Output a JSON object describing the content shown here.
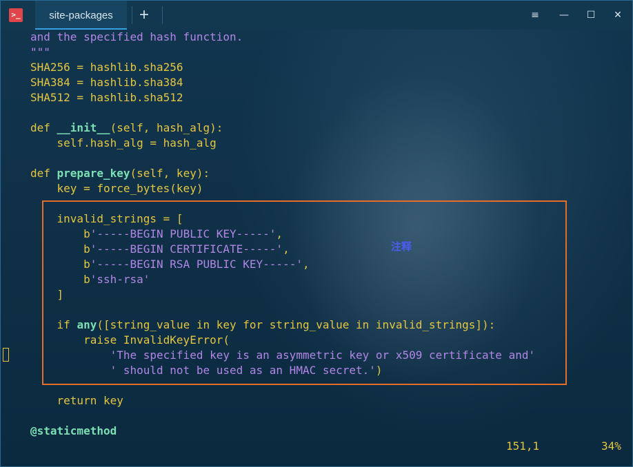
{
  "titlebar": {
    "tab_label": "site-packages",
    "new_tab_label": "+",
    "menu_label": "≡",
    "minimize_label": "—",
    "maximize_label": "☐",
    "close_label": "✕",
    "app_icon_label": ">_"
  },
  "code": {
    "lines": [
      [
        {
          "t": "and the specified hash function.",
          "c": "str"
        }
      ],
      [
        {
          "t": "\"\"\"",
          "c": "str"
        }
      ],
      [
        {
          "t": "SHA256 = hashlib.sha256",
          "c": "kw"
        }
      ],
      [
        {
          "t": "SHA384 = hashlib.sha384",
          "c": "kw"
        }
      ],
      [
        {
          "t": "SHA512 = hashlib.sha512",
          "c": "kw"
        }
      ],
      [
        {
          "t": "",
          "c": "kw"
        }
      ],
      [
        {
          "t": "def ",
          "c": "kw"
        },
        {
          "t": "__init__",
          "c": "fn"
        },
        {
          "t": "(self, hash_alg):",
          "c": "kw"
        }
      ],
      [
        {
          "t": "    self.hash_alg = hash_alg",
          "c": "kw"
        }
      ],
      [
        {
          "t": "",
          "c": "kw"
        }
      ],
      [
        {
          "t": "def ",
          "c": "kw"
        },
        {
          "t": "prepare_key",
          "c": "fn"
        },
        {
          "t": "(self, key):",
          "c": "kw"
        }
      ],
      [
        {
          "t": "    key = force_bytes(key)",
          "c": "kw"
        }
      ],
      [
        {
          "t": "",
          "c": "kw"
        }
      ],
      [
        {
          "t": "    invalid_strings = [",
          "c": "kw"
        }
      ],
      [
        {
          "t": "        b",
          "c": "kw"
        },
        {
          "t": "'-----BEGIN PUBLIC KEY-----'",
          "c": "str"
        },
        {
          "t": ",",
          "c": "kw"
        }
      ],
      [
        {
          "t": "        b",
          "c": "kw"
        },
        {
          "t": "'-----BEGIN CERTIFICATE-----'",
          "c": "str"
        },
        {
          "t": ",",
          "c": "kw"
        }
      ],
      [
        {
          "t": "        b",
          "c": "kw"
        },
        {
          "t": "'-----BEGIN RSA PUBLIC KEY-----'",
          "c": "str"
        },
        {
          "t": ",",
          "c": "kw"
        }
      ],
      [
        {
          "t": "        b",
          "c": "kw"
        },
        {
          "t": "'ssh-rsa'",
          "c": "str"
        }
      ],
      [
        {
          "t": "    ]",
          "c": "kw"
        }
      ],
      [
        {
          "t": "",
          "c": "kw"
        }
      ],
      [
        {
          "t": "    if ",
          "c": "kw"
        },
        {
          "t": "any",
          "c": "fn"
        },
        {
          "t": "([string_value in key for string_value in invalid_strings]):",
          "c": "kw"
        }
      ],
      [
        {
          "t": "        raise InvalidKeyError(",
          "c": "kw"
        }
      ],
      [
        {
          "t": "            ",
          "c": "kw"
        },
        {
          "t": "'The specified key is an asymmetric key or x509 certificate and'",
          "c": "str"
        }
      ],
      [
        {
          "t": "            ",
          "c": "kw"
        },
        {
          "t": "' should not be used as an HMAC secret.'",
          "c": "str"
        },
        {
          "t": ")",
          "c": "kw"
        }
      ],
      [
        {
          "t": "",
          "c": "kw"
        }
      ],
      [
        {
          "t": "    return key",
          "c": "kw"
        }
      ],
      [
        {
          "t": "",
          "c": "kw"
        }
      ],
      [
        {
          "t": "@staticmethod",
          "c": "deco"
        }
      ]
    ]
  },
  "annotation": "注释",
  "status": {
    "position": "151,1",
    "percent": "34%"
  },
  "colors": {
    "keyword": "#e5c640",
    "function": "#7de0b4",
    "string": "#b286e6",
    "highlight_box": "#e36f2a",
    "annotation": "#4d5cf0"
  }
}
